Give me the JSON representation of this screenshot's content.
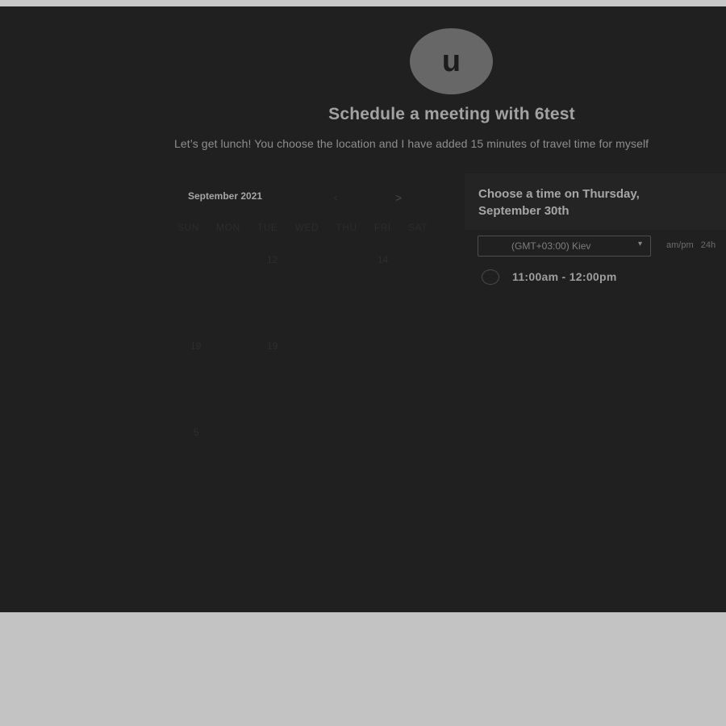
{
  "header": {
    "avatar_letter": "u",
    "title": "Schedule a meeting with 6test",
    "description": "Let’s get lunch! You choose the location and I have added 15 minutes of travel time for myself"
  },
  "calendar": {
    "month_label": "September 2021",
    "prev_label": "‹",
    "next_label": ">",
    "weekdays": [
      "SUN",
      "MON",
      "TUE",
      "WED",
      "THU",
      "FRI",
      "SAT"
    ],
    "visible_days": [
      "12",
      "14",
      "19",
      "19",
      "5"
    ]
  },
  "slots_panel": {
    "title": "Choose a time on Thursday, September 30th",
    "timezone": "(GMT+03:00) Kiev",
    "format_ampm": "am/pm",
    "format_24h": "24h",
    "slots": [
      {
        "label": "11:00am - 12:00pm"
      }
    ]
  },
  "colors": {
    "background_panel": "#202020",
    "outer_background": "#c3c3c3"
  }
}
